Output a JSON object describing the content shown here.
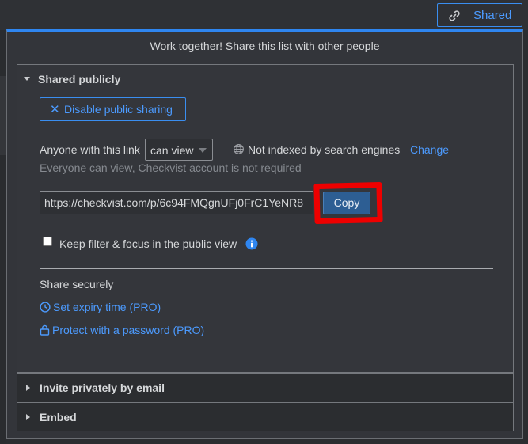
{
  "topbar": {
    "shared_label": "Shared"
  },
  "dialog": {
    "header": "Work together! Share this list with other people",
    "public_section": {
      "title": "Shared publicly",
      "disable_button_label": "Disable public sharing",
      "anyone_label": "Anyone with this link",
      "permission_value": "can view",
      "not_indexed_label": "Not indexed by search engines",
      "change_link": "Change",
      "everyone_note": "Everyone can view, Checkvist account is not required",
      "public_url": "https://checkvist.com/p/6c94FMQgnUFj0FrC1YeNR8",
      "copy_label": "Copy",
      "keep_filter_label": "Keep filter & focus in the public view",
      "keep_filter_checked": false,
      "share_securely_title": "Share securely",
      "expiry_link": "Set expiry time (PRO)",
      "password_link": "Protect with a password (PRO)"
    },
    "invite_section": {
      "title": "Invite privately by email"
    },
    "embed_section": {
      "title": "Embed"
    }
  },
  "colors": {
    "accent": "#4c9bff",
    "copy_button": "#2d5e93",
    "highlight": "#ee0000"
  },
  "icons": [
    "link-icon",
    "close-icon",
    "chevron-down-icon",
    "globe-icon",
    "info-icon",
    "clock-icon",
    "lock-icon",
    "caret-right-icon"
  ]
}
